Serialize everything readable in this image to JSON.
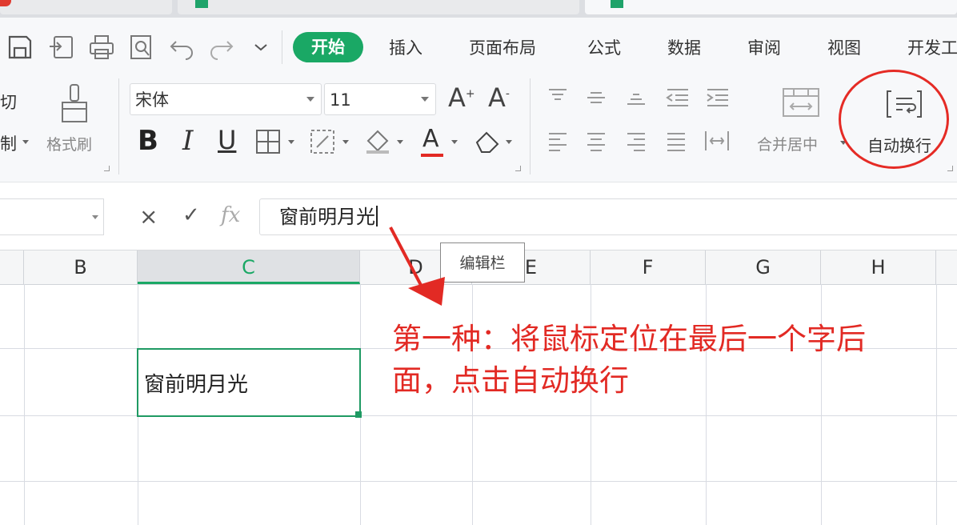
{
  "menu": {
    "start": "开始",
    "items": [
      "插入",
      "页面布局",
      "公式",
      "数据",
      "审阅",
      "视图",
      "开发工"
    ]
  },
  "clipboard": {
    "cut": "切",
    "copy": "制",
    "format_painter": "格式刷"
  },
  "font": {
    "name": "宋体",
    "size": "11"
  },
  "format": {
    "bold": "B",
    "italic": "I",
    "underline": "U",
    "font_color_letter": "A"
  },
  "font_size_buttons": {
    "increase": "A",
    "decrease": "A"
  },
  "alignment": {
    "merge_center": "合并居中",
    "wrap_text": "自动换行"
  },
  "formula_bar": {
    "fx": "fx",
    "cancel": "×",
    "confirm": "✓",
    "content": "窗前明月光"
  },
  "columns": [
    "B",
    "C",
    "D",
    "E",
    "F",
    "G",
    "H"
  ],
  "selected_column": "C",
  "active_cell_value": "窗前明月光",
  "tooltip": "编辑栏",
  "annotation": {
    "line1": "第一种：将鼠标定位在最后一个字后",
    "line2": "面，点击自动换行"
  },
  "colors": {
    "accent": "#1aa865",
    "annotation": "#e22a24"
  }
}
